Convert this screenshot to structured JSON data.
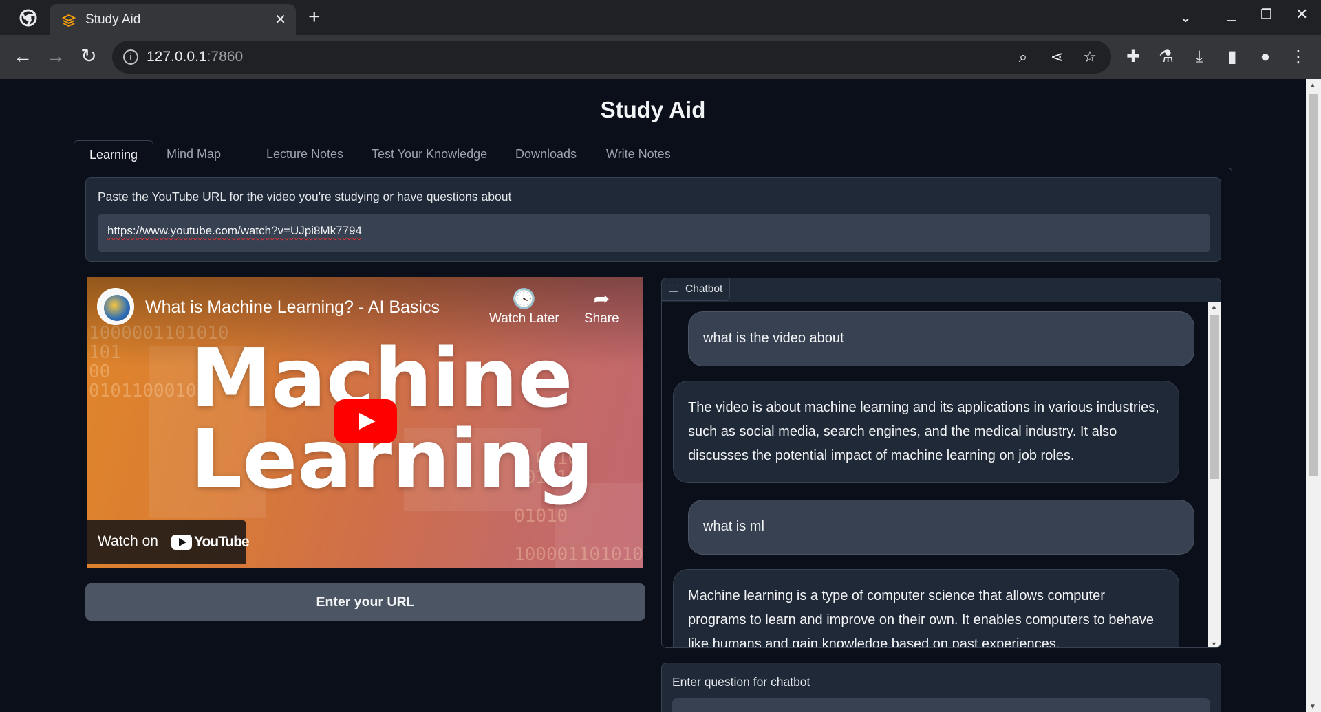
{
  "browser": {
    "tab_title": "Study Aid",
    "url_host": "127.0.0.1",
    "url_port": ":7860"
  },
  "app": {
    "title": "Study Aid",
    "tabs": [
      {
        "label": "Learning",
        "active": true
      },
      {
        "label": "Mind Map"
      },
      {
        "label": "Lecture Notes"
      },
      {
        "label": "Test Your Knowledge"
      },
      {
        "label": "Downloads"
      },
      {
        "label": "Write Notes"
      }
    ]
  },
  "url_section": {
    "label": "Paste the YouTube URL for the video you're studying or have questions about",
    "value": "https://www.youtube.com/watch?v=UJpi8Mk7794"
  },
  "video": {
    "title": "What is Machine Learning? - AI Basics",
    "watch_later": "Watch Later",
    "share": "Share",
    "thumb_line1": "Machine",
    "thumb_line2": "Learning",
    "watch_on": "Watch on",
    "youtube": "YouTube"
  },
  "enter_button": "Enter your URL",
  "chatbot": {
    "label": "Chatbot",
    "messages": [
      {
        "role": "user",
        "text": "what is the video about"
      },
      {
        "role": "bot",
        "text": "The video is about machine learning and its applications in various industries, such as social media, search engines, and the medical industry. It also discusses the potential impact of machine learning on job roles."
      },
      {
        "role": "user",
        "text": "what is ml"
      },
      {
        "role": "bot",
        "text": "Machine learning is a type of computer science that allows computer programs to learn and improve on their own. It enables computers to behave like humans and gain knowledge based on past experiences."
      }
    ]
  },
  "question": {
    "label": "Enter question for chatbot",
    "value": ""
  },
  "colors": {
    "page_bg": "#0b0f19",
    "block_bg": "#1f2937",
    "input_bg": "#374151",
    "youtube_red": "#ff0000"
  }
}
